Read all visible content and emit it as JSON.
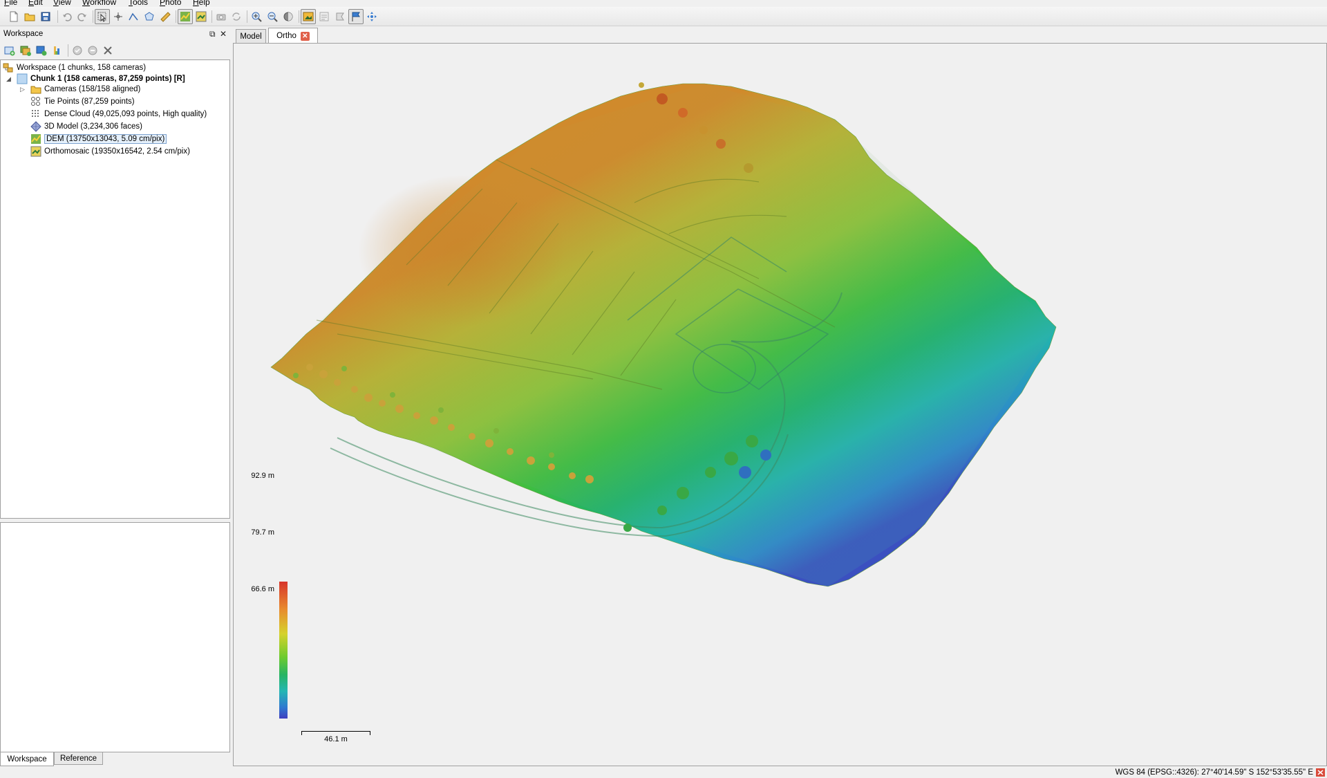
{
  "menu": [
    {
      "key": "F",
      "rest": "ile"
    },
    {
      "key": "E",
      "rest": "dit"
    },
    {
      "key": "V",
      "rest": "iew"
    },
    {
      "key": "W",
      "rest": "orkflow"
    },
    {
      "key": "T",
      "rest": "ools"
    },
    {
      "key": "P",
      "rest": "hoto"
    },
    {
      "key": "H",
      "rest": "elp"
    }
  ],
  "workspace_panel": {
    "title": "Workspace",
    "tree": {
      "root": "Workspace (1 chunks, 158 cameras)",
      "chunk": "Chunk 1 (158 cameras, 87,259 points) [R]",
      "cameras": "Cameras (158/158 aligned)",
      "tie_points": "Tie Points (87,259 points)",
      "dense_cloud": "Dense Cloud (49,025,093 points, High quality)",
      "model": "3D Model (3,234,306 faces)",
      "dem": "DEM (13750x13043, 5.09 cm/pix)",
      "orthomosaic": "Orthomosaic (19350x16542, 2.54 cm/pix)"
    },
    "bottom_tabs": [
      "Workspace",
      "Reference"
    ]
  },
  "view_tabs": [
    "Model",
    "Ortho"
  ],
  "colorbar": {
    "max": "92.9 m",
    "mid": "79.7 m",
    "min": "66.6 m",
    "max_value": 92.9,
    "mid_value": 79.7,
    "min_value": 66.6
  },
  "scalebar": {
    "label": "46.1 m"
  },
  "status": {
    "coordinates": "WGS 84 (EPSG::4326): 27°40'14.59\" S  152°53'35.55\" E"
  },
  "colors": {
    "selection": "#e5f0fb",
    "selection_border": "#7da2ce",
    "panel_bg": "#f0f0f0"
  }
}
